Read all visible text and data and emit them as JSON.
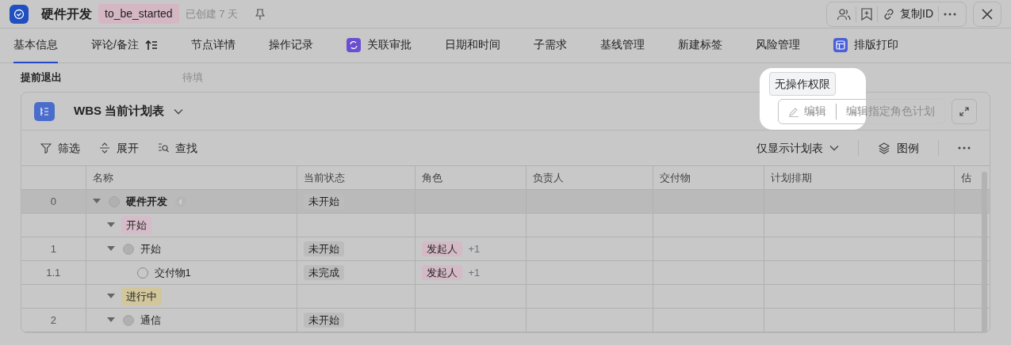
{
  "header": {
    "title": "硬件开发",
    "status_tag": "to_be_started",
    "created": "已创建 7 天",
    "actions": [
      "复制ID"
    ]
  },
  "tabs": [
    {
      "label": "基本信息",
      "selected": true,
      "kind": "plain"
    },
    {
      "label": "评论/备注",
      "selected": false,
      "kind": "sort"
    },
    {
      "label": "节点详情",
      "selected": false,
      "kind": "plain"
    },
    {
      "label": "操作记录",
      "selected": false,
      "kind": "plain"
    },
    {
      "label": "关联审批",
      "selected": false,
      "kind": "approval"
    },
    {
      "label": "日期和时间",
      "selected": false,
      "kind": "plain"
    },
    {
      "label": "子需求",
      "selected": false,
      "kind": "plain"
    },
    {
      "label": "基线管理",
      "selected": false,
      "kind": "plain"
    },
    {
      "label": "新建标签",
      "selected": false,
      "kind": "plain"
    },
    {
      "label": "风险管理",
      "selected": false,
      "kind": "plain"
    },
    {
      "label": "排版打印",
      "selected": false,
      "kind": "print"
    }
  ],
  "field": {
    "label": "提前退出",
    "value": "待填"
  },
  "plan": {
    "title": "WBS 当前计划表",
    "tooltip": "无操作权限",
    "edit_buttons": [
      {
        "label": "编辑",
        "disabled": true,
        "kind": "pencil"
      },
      {
        "label": "编辑指定角色计划",
        "disabled": true,
        "kind": "plain"
      }
    ],
    "tools": [
      {
        "label": "筛选",
        "kind": "filter"
      },
      {
        "label": "展开",
        "kind": "expand"
      },
      {
        "label": "查找",
        "kind": "find"
      }
    ],
    "view_select": "仅显示计划表",
    "legend": "图例"
  },
  "table": {
    "columns": [
      "名称",
      "当前状态",
      "角色",
      "负责人",
      "交付物",
      "计划排期",
      "估"
    ],
    "rows": [
      {
        "kind": "task",
        "index": "0",
        "name": "硬件开发",
        "expanded": true,
        "selected": true,
        "status": "未开始",
        "children": [
          {
            "kind": "group",
            "name": "开始",
            "expanded": true,
            "selected": false,
            "color": "#d6bcc8"
          },
          {
            "kind": "task",
            "index": "1",
            "name": "开始",
            "expanded": true,
            "selected": false,
            "status": "未开始",
            "role": "发起人",
            "role_extra": "+1",
            "children": [
              {
                "kind": "deliverable",
                "index": "1.1",
                "name": "交付物1",
                "selected": false,
                "status": "未完成",
                "role": "发起人",
                "role_extra": "+1"
              }
            ]
          },
          {
            "kind": "group",
            "name": "进行中",
            "expanded": true,
            "selected": false,
            "color": "#d2c79c"
          },
          {
            "kind": "task",
            "index": "2",
            "name": "通信",
            "expanded": true,
            "selected": false,
            "status": "未开始"
          }
        ]
      }
    ]
  }
}
